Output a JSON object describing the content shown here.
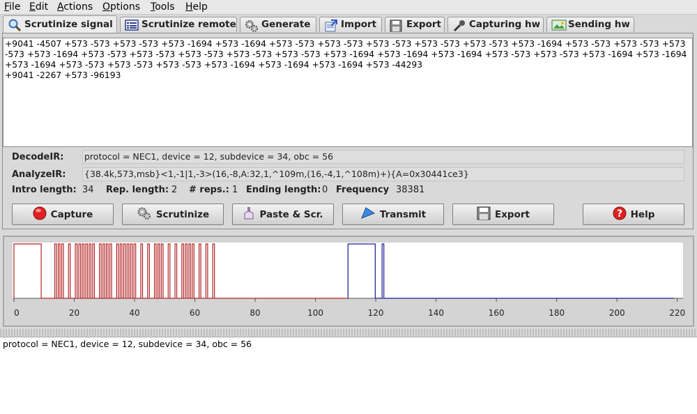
{
  "menubar": {
    "items": [
      "File",
      "Edit",
      "Actions",
      "Options",
      "Tools",
      "Help"
    ]
  },
  "tabs": [
    {
      "label": "Scrutinize signal",
      "icon": "magnifier-icon",
      "active": true
    },
    {
      "label": "Scrutinize remote",
      "icon": "remote-list-icon",
      "active": false
    },
    {
      "label": "Generate",
      "icon": "gears-icon",
      "active": false
    },
    {
      "label": "Import",
      "icon": "import-icon",
      "active": false
    },
    {
      "label": "Export",
      "icon": "floppy-icon",
      "active": false
    },
    {
      "label": "Capturing hw",
      "icon": "microphone-icon",
      "active": false
    },
    {
      "label": "Sending hw",
      "icon": "send-image-icon",
      "active": false
    }
  ],
  "signal_text": "+9041 -4507 +573 -573 +573 -573 +573 -1694 +573 -1694 +573 -573 +573 -573 +573 -573 +573 -573 +573 -573 +573 -1694 +573 -573 +573 -573 +573 -573 +573 -1694 +573 -573 +573 -573 +573 -573 +573 -573 +573 -573 +573 -1694 +573 -1694 +573 -1694 +573 -573 +573 -573 +573 -1694 +573 -1694 +573 -1694 +573 -573 +573 -573 +573 -573 +573 -1694 +573 -1694 +573 -1694 +573 -44293\n+9041 -2267 +573 -96193",
  "decode": {
    "decode_label": "DecodeIR:",
    "decode_value": "protocol = NEC1, device = 12, subdevice = 34, obc = 56",
    "analyze_label": "AnalyzeIR:",
    "analyze_value": "{38.4k,573,msb}<1,-1|1,-3>(16,-8,A:32,1,^109m,(16,-4,1,^108m)+){A=0x30441ce3}"
  },
  "info": {
    "intro_label": "Intro length:",
    "intro_value": "34",
    "rep_label": "Rep. length:",
    "rep_value": "2",
    "reps_label": "# reps.:",
    "reps_value": "1",
    "ending_label": "Ending length:",
    "ending_value": "0",
    "freq_label": "Frequency",
    "freq_value": "38381"
  },
  "buttons": {
    "capture": "Capture",
    "scrutinize": "Scrutinize",
    "paste": "Paste & Scr.",
    "transmit": "Transmit",
    "export": "Export",
    "help": "Help"
  },
  "colors": {
    "intro_signal": "#b22222",
    "repeat_signal": "#1a1a9a",
    "plot_background": "#ffffff"
  },
  "chart_data": {
    "type": "line",
    "x_ticks": [
      0,
      20,
      40,
      60,
      80,
      100,
      120,
      140,
      160,
      180,
      200,
      220
    ],
    "xlim": [
      0,
      221
    ],
    "unit_ms": 0.573,
    "series": [
      {
        "role": "intro",
        "durations_us": [
          9041,
          4507,
          573,
          573,
          573,
          573,
          573,
          1694,
          573,
          1694,
          573,
          573,
          573,
          573,
          573,
          573,
          573,
          573,
          573,
          573,
          573,
          1694,
          573,
          573,
          573,
          573,
          573,
          573,
          573,
          1694,
          573,
          573,
          573,
          573,
          573,
          573,
          573,
          573,
          573,
          573,
          573,
          1694,
          573,
          1694,
          573,
          1694,
          573,
          573,
          573,
          573,
          573,
          1694,
          573,
          1694,
          573,
          1694,
          573,
          573,
          573,
          573,
          573,
          573,
          573,
          1694,
          573,
          1694,
          573,
          1694,
          573,
          44293
        ]
      },
      {
        "role": "repeat",
        "durations_us": [
          9041,
          2267,
          573,
          96193
        ]
      }
    ]
  },
  "console_text": "protocol = NEC1, device = 12, subdevice = 34, obc = 56"
}
